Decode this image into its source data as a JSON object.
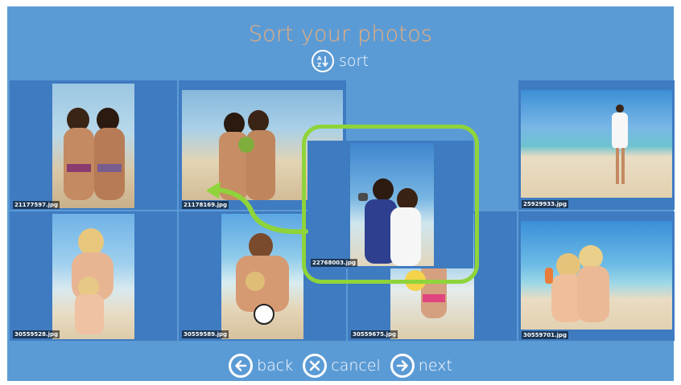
{
  "header": {
    "title": "Sort your photos",
    "sort_label": "sort",
    "sort_icon": "sort-az-icon"
  },
  "photos": [
    {
      "filename": "21177597.jpg"
    },
    {
      "filename": "21178169.jpg"
    },
    {
      "filename": "25929933.jpg"
    },
    {
      "filename": "30559528.jpg"
    },
    {
      "filename": "30559589.jpg"
    },
    {
      "filename": "30559675.jpg"
    },
    {
      "filename": "30559701.jpg"
    },
    {
      "filename": "22768003.jpg"
    }
  ],
  "footer": {
    "back_label": "back",
    "cancel_label": "cancel",
    "next_label": "next"
  },
  "colors": {
    "background": "#5b9bd5",
    "tile": "#3f7bc1",
    "title": "#ecae79",
    "highlight": "#8ed43a"
  }
}
